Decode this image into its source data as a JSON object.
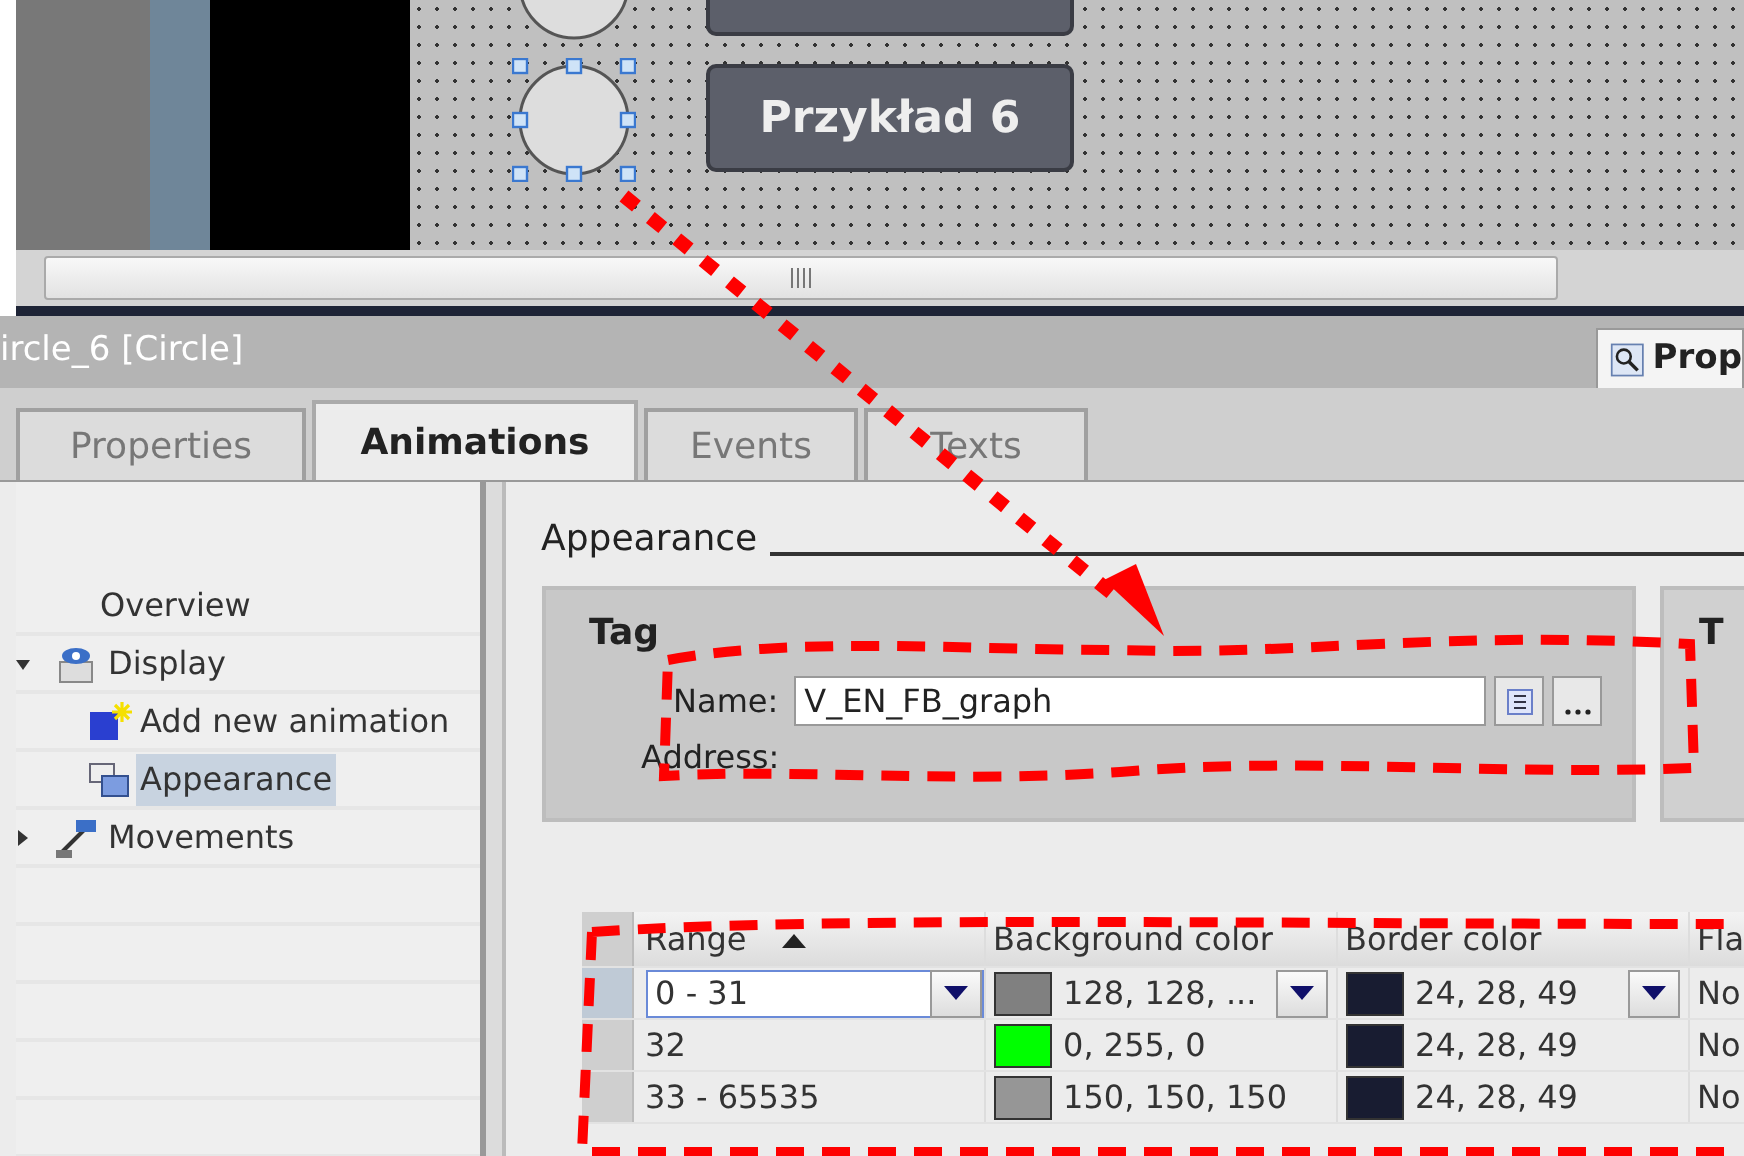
{
  "canvas": {
    "button_label": "Przykład 6",
    "circle_selected": true
  },
  "panel": {
    "title": "ircle_6 [Circle]",
    "side_tab": "Prop"
  },
  "tabs": [
    {
      "label": "Properties",
      "selected": false
    },
    {
      "label": "Animations",
      "selected": true
    },
    {
      "label": "Events",
      "selected": false
    },
    {
      "label": "Texts",
      "selected": false
    }
  ],
  "tree": [
    {
      "label": "Overview",
      "kind": "leaf",
      "selected": false
    },
    {
      "label": "Display",
      "kind": "display",
      "expanded": true,
      "selected": false,
      "children": [
        {
          "label": "Add new animation",
          "kind": "add",
          "selected": false
        },
        {
          "label": "Appearance",
          "kind": "appearance",
          "selected": true
        }
      ]
    },
    {
      "label": "Movements",
      "kind": "movements",
      "expanded": false,
      "selected": false
    }
  ],
  "section_title": "Appearance",
  "tag": {
    "group_title": "Tag",
    "name_label": "Name:",
    "name_value": "V_EN_FB_graph",
    "address_label": "Address:",
    "side_group_title": "T"
  },
  "table": {
    "columns": [
      {
        "label": "Range",
        "sorted": true
      },
      {
        "label": "Background color",
        "sorted": false
      },
      {
        "label": "Border color",
        "sorted": false
      },
      {
        "label": "Fla",
        "sorted": false
      }
    ],
    "rows": [
      {
        "range": "0 - 31",
        "background": {
          "text": "128, 128, ...",
          "color": "#808080"
        },
        "border": {
          "text": "24, 28, 49",
          "color": "#181c31"
        },
        "column_4": "No",
        "selected": true
      },
      {
        "range": "32",
        "background": {
          "text": "0, 255, 0",
          "color": "#00ff00"
        },
        "border": {
          "text": "24, 28, 49",
          "color": "#181c31"
        },
        "column_4": "No",
        "selected": false
      },
      {
        "range": "33 - 65535",
        "background": {
          "text": "150, 150, 150",
          "color": "#969696"
        },
        "border": {
          "text": "24, 28, 49",
          "color": "#181c31"
        },
        "column_4": "No",
        "selected": false
      }
    ]
  }
}
